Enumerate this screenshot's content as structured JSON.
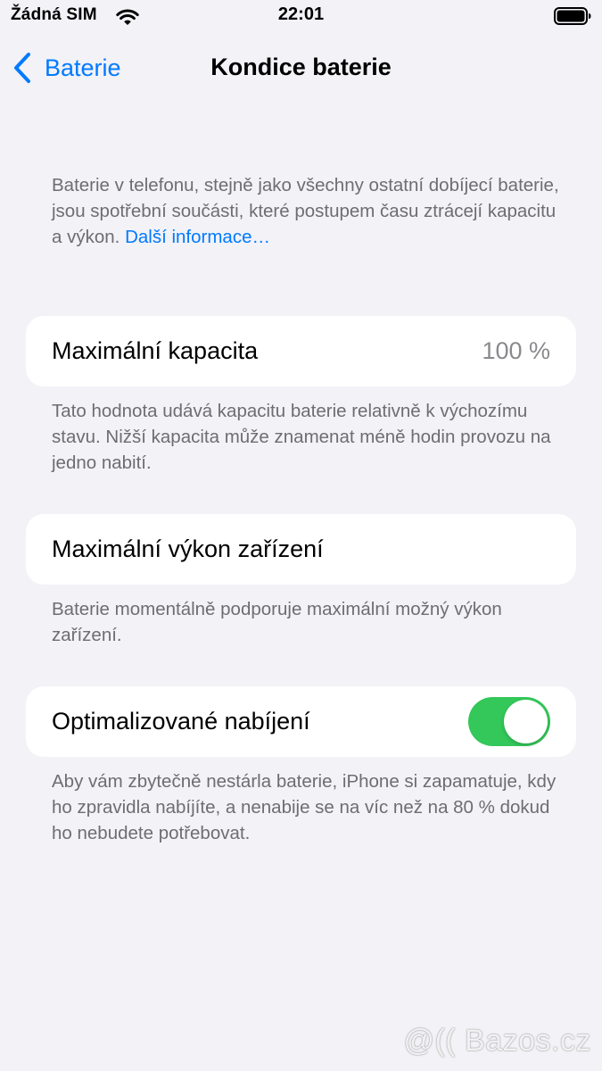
{
  "status_bar": {
    "carrier": "Žádná SIM",
    "time": "22:01",
    "icons": [
      "wifi-icon",
      "battery-icon"
    ]
  },
  "nav": {
    "back_label": "Baterie",
    "back_icon": "chevron-left-icon",
    "title": "Kondice baterie"
  },
  "intro": {
    "text": "Baterie v telefonu, stejně jako všechny ostatní dobíjecí baterie, jsou spotřební součásti, které postupem času ztrácejí kapacitu a výkon.",
    "link": "Další informace…"
  },
  "max_capacity": {
    "label": "Maximální kapacita",
    "value": "100 %",
    "note": "Tato hodnota udává kapacitu baterie relativně k výchozímu stavu. Nižší kapacita může znamenat méně hodin provozu na jedno nabití."
  },
  "peak_performance": {
    "label": "Maximální výkon zařízení",
    "note": "Baterie momentálně podporuje maximální možný výkon zařízení."
  },
  "optimized_charging": {
    "label": "Optimalizované nabíjení",
    "enabled": true,
    "note": "Aby vám zbytečně nestárla baterie, iPhone si zapamatuje, kdy ho zpravidla nabíjíte, a nenabije se na víc než na 80 % dokud ho nebudete potřebovat."
  },
  "colors": {
    "accent": "#007aff",
    "toggle_on": "#34c759",
    "background": "#f2f2f7",
    "secondary_text": "#6d6d72"
  },
  "watermark": {
    "text": "@(( Bazos.cz"
  }
}
